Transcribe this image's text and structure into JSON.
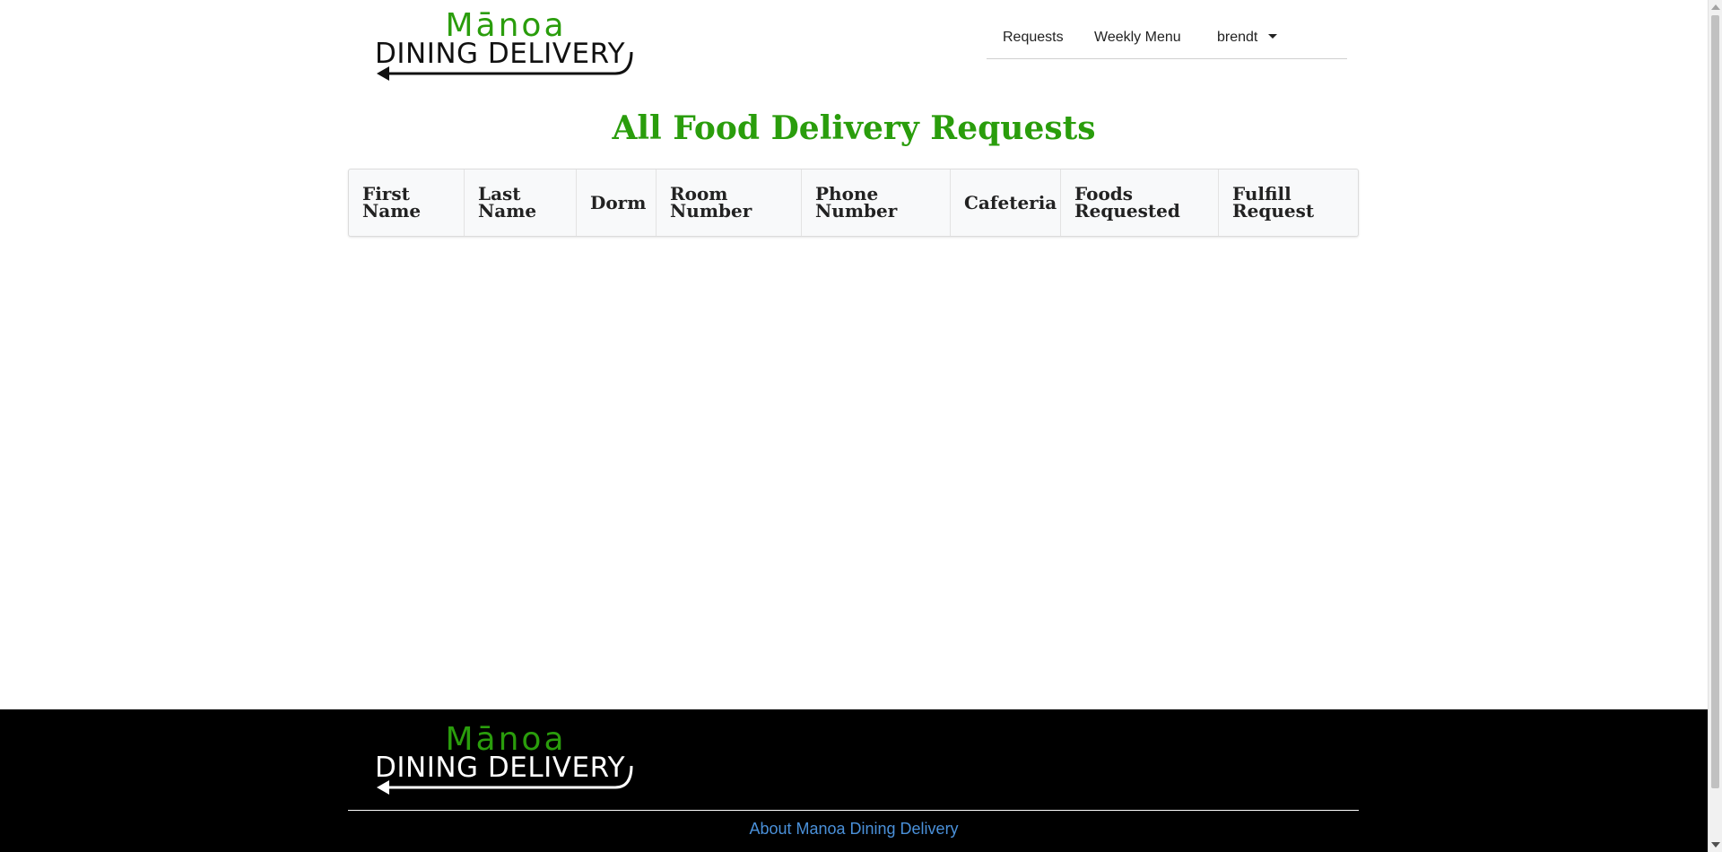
{
  "logo": {
    "top_text": "Mānoa",
    "bottom_text": "DINING DELIVERY"
  },
  "nav": {
    "requests_label": "Requests",
    "weekly_menu_label": "Weekly Menu",
    "user_label": "brendt"
  },
  "page_title": "All Food Delivery Requests",
  "table": {
    "headers": [
      "First Name",
      "Last Name",
      "Dorm",
      "Room Number",
      "Phone Number",
      "Cafeteria",
      "Foods Requested",
      "Fulfill Request"
    ],
    "rows": []
  },
  "footer": {
    "about_link": "About Manoa Dining Delivery"
  },
  "colors": {
    "brand_green": "#2a9d0c",
    "footer_bg": "#000000",
    "link_blue": "#4a90d9"
  }
}
